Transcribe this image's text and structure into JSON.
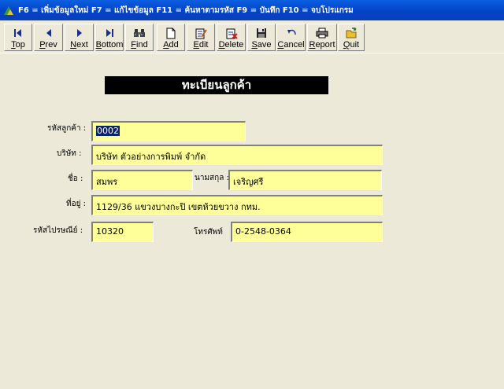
{
  "window": {
    "title": "F6 = เพิ่มข้อมูลใหม่ F7 = แก้ไขข้อมูล  F11 = ค้นหาตามรหัส F9 = บันทึก  F10 = จบโปรแกรม"
  },
  "toolbar": {
    "buttons": [
      {
        "hot": "T",
        "rest": "op",
        "icon": "first-record-icon"
      },
      {
        "hot": "P",
        "rest": "rev",
        "icon": "prev-record-icon"
      },
      {
        "hot": "N",
        "rest": "ext",
        "icon": "next-record-icon"
      },
      {
        "hot": "B",
        "rest": "ottom",
        "icon": "last-record-icon"
      },
      {
        "hot": "F",
        "rest": "ind",
        "icon": "binoculars-icon"
      },
      {
        "hot": "A",
        "rest": "dd",
        "icon": "new-document-icon"
      },
      {
        "hot": "E",
        "rest": "dit",
        "icon": "edit-document-icon"
      },
      {
        "hot": "D",
        "rest": "elete",
        "icon": "delete-document-icon"
      },
      {
        "hot": "S",
        "rest": "ave",
        "icon": "floppy-disk-icon"
      },
      {
        "hot": "C",
        "rest": "ancel",
        "icon": "undo-arrow-icon"
      },
      {
        "hot": "R",
        "rest": "eport",
        "icon": "printer-icon"
      },
      {
        "hot": "Q",
        "rest": "uit",
        "icon": "exit-door-icon"
      }
    ]
  },
  "form": {
    "heading": "ทะเบียนลูกค้า",
    "customer_code": {
      "label": "รหัสลูกค้า :",
      "value": "0002"
    },
    "company": {
      "label": "บริษัท :",
      "value": "บริษัท ตัวอย่างการพิมพ์ จำกัด"
    },
    "first_name": {
      "label": "ชื่อ :",
      "value": "สมพร"
    },
    "last_name": {
      "label": "นามสกุล :",
      "value": "เจริญศรี"
    },
    "address": {
      "label": "ที่อยู่ :",
      "value": "1129/36 แขวงบางกะปิ เขตห้วยขวาง กทม."
    },
    "postcode": {
      "label": "รหัสไปรษณีย์ :",
      "value": "10320"
    },
    "phone": {
      "label": "โทรศัพท์",
      "value": "0-2548-0364"
    }
  },
  "colors": {
    "field_bg": "#FFFF99",
    "window_bg": "#ECE9D8",
    "titlebar": "#0343C9",
    "heading_bg": "#000000",
    "selection": "#0A246A"
  }
}
